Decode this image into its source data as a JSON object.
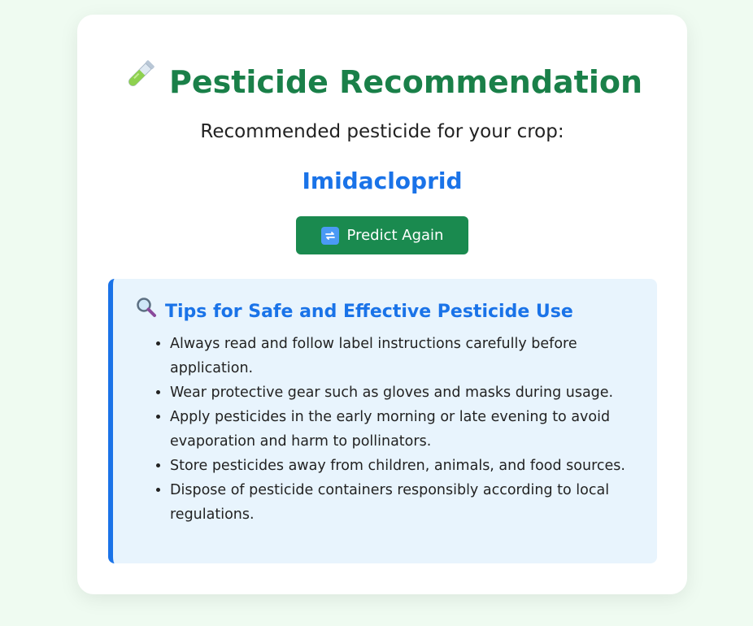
{
  "title": "Pesticide Recommendation",
  "subtitle": "Recommended pesticide for your crop:",
  "result": "Imidacloprid",
  "predict_button": "Predict Again",
  "tips": {
    "title": "Tips for Safe and Effective Pesticide Use",
    "items": [
      "Always read and follow label instructions carefully before application.",
      "Wear protective gear such as gloves and masks during usage.",
      "Apply pesticides in the early morning or late evening to avoid evaporation and harm to pollinators.",
      "Store pesticides away from children, animals, and food sources.",
      "Dispose of pesticide containers responsibly according to local regulations."
    ]
  },
  "icons": {
    "title": "test-tube-icon",
    "button": "refresh-icon",
    "tips": "magnifying-glass-icon"
  },
  "colors": {
    "background": "#effbf1",
    "title_green": "#1a8049",
    "button_green": "#1a8a4f",
    "accent_blue": "#1a73e8",
    "tips_bg": "#e8f4fd"
  }
}
